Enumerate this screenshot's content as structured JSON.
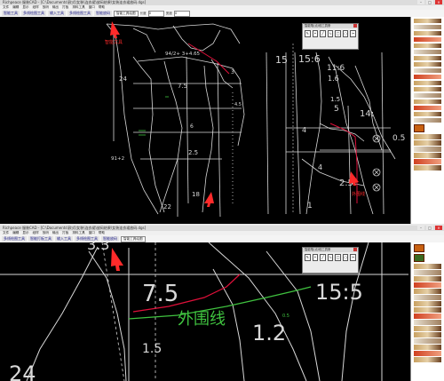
{
  "window1": {
    "title": "Richpeace 服装CAD - [C:\\Documents\\款式\\女装\\连衣裙\\放码结果\\女装连衣裙放码.dgs]",
    "menu": [
      "文件",
      "编辑",
      "显示",
      "纸样",
      "放码",
      "输出",
      "打板",
      "排料工具",
      "窗口",
      "帮助"
    ],
    "toolbar_tabs": [
      "智能工具",
      "多线绘图工具",
      "输入工具",
      "多线绘图工具",
      "智能放码"
    ],
    "select_value": "智能工具绘图",
    "label_a": "长度",
    "label_b": "宽度",
    "input_a": "0",
    "input_b": "0",
    "annotation_top": "智能工具",
    "annotation_bottom": "外围线",
    "tool_panel_title": "智能笔/点/线工具条",
    "drawing_labels": [
      "94/2+ 3+4.65",
      "91+2",
      "2.5",
      "15:6",
      "11:6",
      "1.6",
      "14:",
      "2.5",
      "0.5",
      "15",
      "24",
      "18",
      "22",
      "4.5",
      "1.5",
      "6",
      "5",
      "4",
      "4",
      "7.5",
      "3",
      "1"
    ]
  },
  "window2": {
    "title": "Richpeace 服装CAD - [C:\\Documents\\款式\\女装\\连衣裙\\放码结果\\女装连衣裙放码.dgs]",
    "menu": [
      "文件",
      "编辑",
      "显示",
      "纸样",
      "放码",
      "输出",
      "打板",
      "排料工具",
      "窗口",
      "帮助"
    ],
    "toolbar_tabs": [
      "多线绘图工具",
      "智能打板工具",
      "输入工具",
      "多线绘图工具",
      "智能放码"
    ],
    "select_value": "智能工具绘图",
    "tool_panel_title": "智能笔/点/线工具条",
    "green_label": "外围线",
    "small_green_label": "0.5",
    "drawing_labels": [
      "3.3",
      "7.5",
      "15:5",
      "1.2",
      "1.5",
      "24"
    ]
  },
  "colors": {
    "canvas": "#000000",
    "drawing_line": "#d8d8d8",
    "red_curve": "#e0103a",
    "green_text": "#3fc23f",
    "annotation": "#ff2a2a"
  }
}
